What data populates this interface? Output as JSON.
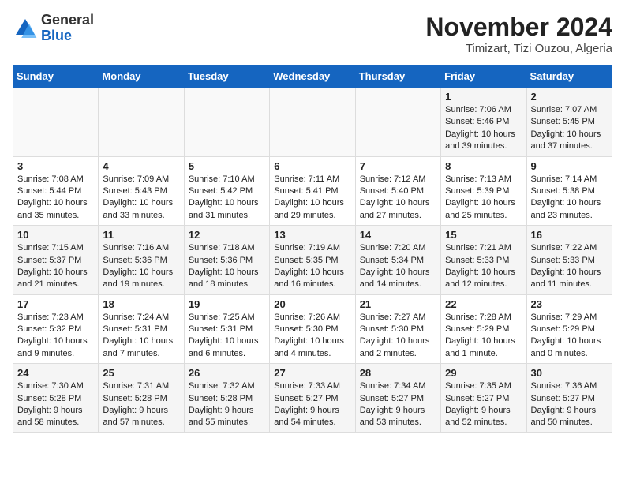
{
  "header": {
    "logo_general": "General",
    "logo_blue": "Blue",
    "month_title": "November 2024",
    "location": "Timizart, Tizi Ouzou, Algeria"
  },
  "days_of_week": [
    "Sunday",
    "Monday",
    "Tuesday",
    "Wednesday",
    "Thursday",
    "Friday",
    "Saturday"
  ],
  "weeks": [
    [
      {
        "day": "",
        "info": ""
      },
      {
        "day": "",
        "info": ""
      },
      {
        "day": "",
        "info": ""
      },
      {
        "day": "",
        "info": ""
      },
      {
        "day": "",
        "info": ""
      },
      {
        "day": "1",
        "info": "Sunrise: 7:06 AM\nSunset: 5:46 PM\nDaylight: 10 hours and 39 minutes."
      },
      {
        "day": "2",
        "info": "Sunrise: 7:07 AM\nSunset: 5:45 PM\nDaylight: 10 hours and 37 minutes."
      }
    ],
    [
      {
        "day": "3",
        "info": "Sunrise: 7:08 AM\nSunset: 5:44 PM\nDaylight: 10 hours and 35 minutes."
      },
      {
        "day": "4",
        "info": "Sunrise: 7:09 AM\nSunset: 5:43 PM\nDaylight: 10 hours and 33 minutes."
      },
      {
        "day": "5",
        "info": "Sunrise: 7:10 AM\nSunset: 5:42 PM\nDaylight: 10 hours and 31 minutes."
      },
      {
        "day": "6",
        "info": "Sunrise: 7:11 AM\nSunset: 5:41 PM\nDaylight: 10 hours and 29 minutes."
      },
      {
        "day": "7",
        "info": "Sunrise: 7:12 AM\nSunset: 5:40 PM\nDaylight: 10 hours and 27 minutes."
      },
      {
        "day": "8",
        "info": "Sunrise: 7:13 AM\nSunset: 5:39 PM\nDaylight: 10 hours and 25 minutes."
      },
      {
        "day": "9",
        "info": "Sunrise: 7:14 AM\nSunset: 5:38 PM\nDaylight: 10 hours and 23 minutes."
      }
    ],
    [
      {
        "day": "10",
        "info": "Sunrise: 7:15 AM\nSunset: 5:37 PM\nDaylight: 10 hours and 21 minutes."
      },
      {
        "day": "11",
        "info": "Sunrise: 7:16 AM\nSunset: 5:36 PM\nDaylight: 10 hours and 19 minutes."
      },
      {
        "day": "12",
        "info": "Sunrise: 7:18 AM\nSunset: 5:36 PM\nDaylight: 10 hours and 18 minutes."
      },
      {
        "day": "13",
        "info": "Sunrise: 7:19 AM\nSunset: 5:35 PM\nDaylight: 10 hours and 16 minutes."
      },
      {
        "day": "14",
        "info": "Sunrise: 7:20 AM\nSunset: 5:34 PM\nDaylight: 10 hours and 14 minutes."
      },
      {
        "day": "15",
        "info": "Sunrise: 7:21 AM\nSunset: 5:33 PM\nDaylight: 10 hours and 12 minutes."
      },
      {
        "day": "16",
        "info": "Sunrise: 7:22 AM\nSunset: 5:33 PM\nDaylight: 10 hours and 11 minutes."
      }
    ],
    [
      {
        "day": "17",
        "info": "Sunrise: 7:23 AM\nSunset: 5:32 PM\nDaylight: 10 hours and 9 minutes."
      },
      {
        "day": "18",
        "info": "Sunrise: 7:24 AM\nSunset: 5:31 PM\nDaylight: 10 hours and 7 minutes."
      },
      {
        "day": "19",
        "info": "Sunrise: 7:25 AM\nSunset: 5:31 PM\nDaylight: 10 hours and 6 minutes."
      },
      {
        "day": "20",
        "info": "Sunrise: 7:26 AM\nSunset: 5:30 PM\nDaylight: 10 hours and 4 minutes."
      },
      {
        "day": "21",
        "info": "Sunrise: 7:27 AM\nSunset: 5:30 PM\nDaylight: 10 hours and 2 minutes."
      },
      {
        "day": "22",
        "info": "Sunrise: 7:28 AM\nSunset: 5:29 PM\nDaylight: 10 hours and 1 minute."
      },
      {
        "day": "23",
        "info": "Sunrise: 7:29 AM\nSunset: 5:29 PM\nDaylight: 10 hours and 0 minutes."
      }
    ],
    [
      {
        "day": "24",
        "info": "Sunrise: 7:30 AM\nSunset: 5:28 PM\nDaylight: 9 hours and 58 minutes."
      },
      {
        "day": "25",
        "info": "Sunrise: 7:31 AM\nSunset: 5:28 PM\nDaylight: 9 hours and 57 minutes."
      },
      {
        "day": "26",
        "info": "Sunrise: 7:32 AM\nSunset: 5:28 PM\nDaylight: 9 hours and 55 minutes."
      },
      {
        "day": "27",
        "info": "Sunrise: 7:33 AM\nSunset: 5:27 PM\nDaylight: 9 hours and 54 minutes."
      },
      {
        "day": "28",
        "info": "Sunrise: 7:34 AM\nSunset: 5:27 PM\nDaylight: 9 hours and 53 minutes."
      },
      {
        "day": "29",
        "info": "Sunrise: 7:35 AM\nSunset: 5:27 PM\nDaylight: 9 hours and 52 minutes."
      },
      {
        "day": "30",
        "info": "Sunrise: 7:36 AM\nSunset: 5:27 PM\nDaylight: 9 hours and 50 minutes."
      }
    ]
  ]
}
